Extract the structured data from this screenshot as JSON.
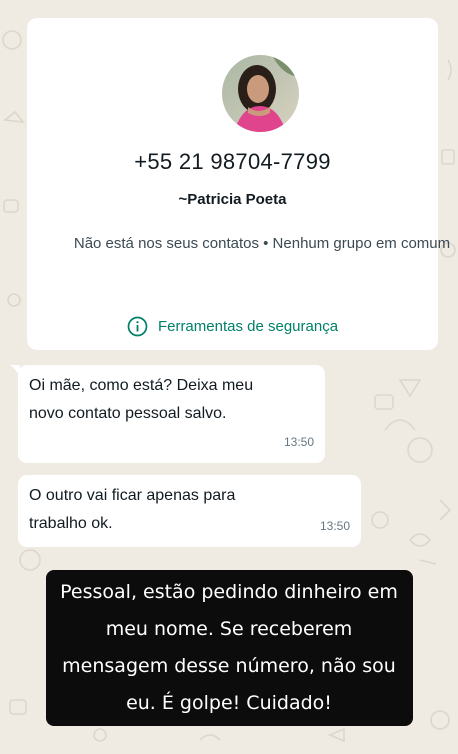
{
  "contact": {
    "phone": "+55 21 98704-7799",
    "pushname": "~Patricia Poeta",
    "info": "Não está nos seus contatos • Nenhum grupo em comum",
    "security_tools_label": "Ferramentas de segurança"
  },
  "messages": [
    {
      "text_lines": [
        "Oi mãe, como está? Deixa meu",
        "novo contato pessoal salvo."
      ],
      "time": "13:50"
    },
    {
      "text_lines": [
        "O outro vai ficar apenas para",
        "trabalho ok."
      ],
      "time": "13:50"
    }
  ],
  "overlay": {
    "text": "Pessoal, estão pedindo dinheiro em meu nome. Se receberem mensagem desse número, não sou eu. É golpe! Cuidado!"
  },
  "colors": {
    "chat_background": "#efeae2",
    "bubble": "#ffffff",
    "accent_green": "#008069",
    "timestamp_gray": "#667781",
    "overlay_background": "#0c0c0c"
  },
  "icons": [
    "info-icon",
    "avatar-photo"
  ]
}
